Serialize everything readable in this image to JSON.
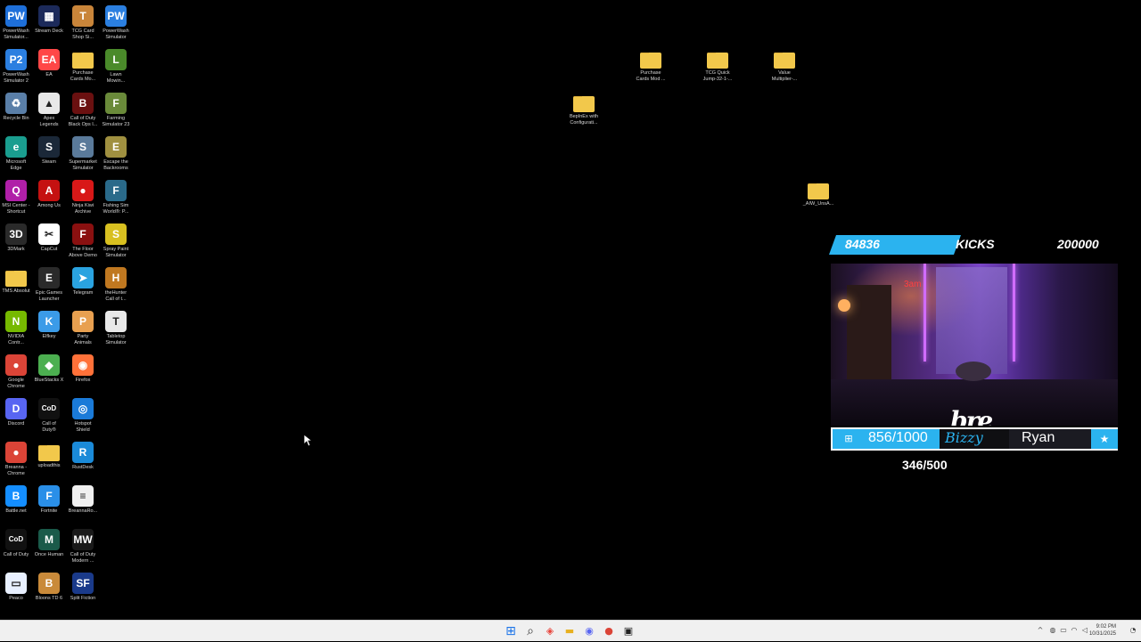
{
  "desktop": {
    "col1": [
      {
        "label": "PowerWash\nSimulator...",
        "icon": "powerwash-icon",
        "color": "#1e6fd9",
        "glyph": "PW"
      },
      {
        "label": "PowerWash\nSimulator 2",
        "icon": "powerwash2-icon",
        "color": "#2b7fe0",
        "glyph": "P2"
      },
      {
        "label": "Recycle Bin",
        "icon": "recycle-bin-icon",
        "color": "#5a7fa8",
        "glyph": "♻"
      },
      {
        "label": "Microsoft\nEdge",
        "icon": "edge-icon",
        "color": "#1a9e8f",
        "glyph": "e"
      },
      {
        "label": "MSI Center -\nShortcut",
        "icon": "msi-center-icon",
        "color": "#b01fa8",
        "glyph": "Q"
      },
      {
        "label": "3DMark",
        "icon": "3dmark-icon",
        "color": "#2a2a2a",
        "glyph": "3D"
      },
      {
        "label": "TMS Absolut",
        "icon": "folder-icon",
        "color": "#f2c84b",
        "glyph": ""
      },
      {
        "label": "NVIDIA\nContr...",
        "icon": "nvidia-icon",
        "color": "#76b900",
        "glyph": "N"
      },
      {
        "label": "Google\nChrome",
        "icon": "chrome-icon",
        "color": "#db4437",
        "glyph": "●"
      },
      {
        "label": "Discord",
        "icon": "discord-icon",
        "color": "#5865f2",
        "glyph": "D"
      },
      {
        "label": "Breanna -\nChrome",
        "icon": "chrome-profile-icon",
        "color": "#db4437",
        "glyph": "●"
      },
      {
        "label": "Battle.net",
        "icon": "battlenet-icon",
        "color": "#148eff",
        "glyph": "B"
      },
      {
        "label": "Call of Duty",
        "icon": "cod-icon",
        "color": "#111111",
        "glyph": "CoD"
      },
      {
        "label": "Peaco",
        "icon": "peaco-icon",
        "color": "#e8f0ff",
        "glyph": "▭"
      }
    ],
    "col2": [
      {
        "label": "Stream Deck",
        "icon": "stream-deck-icon",
        "color": "#1c2a5a",
        "glyph": "▦"
      },
      {
        "label": "EA",
        "icon": "ea-icon",
        "color": "#ff4747",
        "glyph": "EA"
      },
      {
        "label": "Apex\nLegends",
        "icon": "apex-icon",
        "color": "#e8e8e8",
        "glyph": "▲"
      },
      {
        "label": "Steam",
        "icon": "steam-icon",
        "color": "#1b2838",
        "glyph": "S"
      },
      {
        "label": "Among Us",
        "icon": "among-us-icon",
        "color": "#c51111",
        "glyph": "A"
      },
      {
        "label": "CapCut",
        "icon": "capcut-icon",
        "color": "#ffffff",
        "glyph": "✂"
      },
      {
        "label": "Epic Games\nLauncher",
        "icon": "epic-icon",
        "color": "#2a2a2a",
        "glyph": "E"
      },
      {
        "label": "Elfkey",
        "icon": "elfkey-icon",
        "color": "#3b9be8",
        "glyph": "K"
      },
      {
        "label": "BlueStacks X",
        "icon": "bluestacks-icon",
        "color": "#4caf50",
        "glyph": "◆"
      },
      {
        "label": "Call of\nDuty®",
        "icon": "cod-icon",
        "color": "#111111",
        "glyph": "CoD"
      },
      {
        "label": "uploadthis",
        "icon": "folder-icon",
        "color": "#f2c84b",
        "glyph": ""
      },
      {
        "label": "Fortnite",
        "icon": "fortnite-icon",
        "color": "#2a8fe8",
        "glyph": "F"
      },
      {
        "label": "Once Human",
        "icon": "once-human-icon",
        "color": "#1a5a4a",
        "glyph": "M"
      },
      {
        "label": "Bloons TD 6",
        "icon": "bloons-icon",
        "color": "#c98a3a",
        "glyph": "B"
      }
    ],
    "col3": [
      {
        "label": "TCG Card\nShop Si...",
        "icon": "tcg-icon",
        "color": "#c9853a",
        "glyph": "T"
      },
      {
        "label": "Purchase\nCards Mo...",
        "icon": "folder-icon",
        "color": "#f2c84b",
        "glyph": ""
      },
      {
        "label": "Call of Duty\nBlack Ops I...",
        "icon": "cod-bo-icon",
        "color": "#6a1010",
        "glyph": "B"
      },
      {
        "label": "Supermarket\nSimulator",
        "icon": "supermarket-icon",
        "color": "#5a7a9a",
        "glyph": "S"
      },
      {
        "label": "Ninja Kiwi\nArchive",
        "icon": "ninja-kiwi-icon",
        "color": "#d81818",
        "glyph": "●"
      },
      {
        "label": "The Floor\nAbove Demo",
        "icon": "floor-above-icon",
        "color": "#8a1010",
        "glyph": "F"
      },
      {
        "label": "Telegram",
        "icon": "telegram-icon",
        "color": "#2aa3e0",
        "glyph": "➤"
      },
      {
        "label": "Party\nAnimals",
        "icon": "party-animals-icon",
        "color": "#e8a050",
        "glyph": "P"
      },
      {
        "label": "Firefox",
        "icon": "firefox-icon",
        "color": "#ff7139",
        "glyph": "◉"
      },
      {
        "label": "Hotspot\nShield",
        "icon": "hotspot-icon",
        "color": "#1a7ad8",
        "glyph": "◎"
      },
      {
        "label": "RustDesk",
        "icon": "rustdesk-icon",
        "color": "#1a8ad8",
        "glyph": "R"
      },
      {
        "label": "BreannaRo...",
        "icon": "document-icon",
        "color": "#f0f0f0",
        "glyph": "≡"
      },
      {
        "label": "Call of Duty\nModern ...",
        "icon": "mw2-icon",
        "color": "#1a1a1a",
        "glyph": "MW"
      },
      {
        "label": "Split Fiction",
        "icon": "split-fiction-icon",
        "color": "#1a3a8a",
        "glyph": "SF"
      }
    ],
    "col4": [
      {
        "label": "PowerWash\nSimulator",
        "icon": "powerwash-icon",
        "color": "#2b7fe0",
        "glyph": "PW"
      },
      {
        "label": "Lawn\nMowin...",
        "icon": "lawn-icon",
        "color": "#4a8a2a",
        "glyph": "L"
      },
      {
        "label": "Farming\nSimulator 23",
        "icon": "farming-icon",
        "color": "#6a8a3a",
        "glyph": "F"
      },
      {
        "label": "Escape the\nBackrooms",
        "icon": "backrooms-icon",
        "color": "#a09040",
        "glyph": "E"
      },
      {
        "label": "Fishing Sim\nWorld®: P...",
        "icon": "fishing-icon",
        "color": "#2a6a8a",
        "glyph": "F"
      },
      {
        "label": "Spray Paint\nSimulator",
        "icon": "spray-paint-icon",
        "color": "#d8c020",
        "glyph": "S"
      },
      {
        "label": "theHunter\nCall of t...",
        "icon": "thehunter-icon",
        "color": "#c07820",
        "glyph": "H"
      },
      {
        "label": "Tabletop\nSimulator",
        "icon": "tabletop-icon",
        "color": "#e8e8e8",
        "glyph": "T"
      }
    ],
    "loose": [
      {
        "label": "Purchase\nCards Mod ...",
        "icon": "folder-icon"
      },
      {
        "label": "TCG Quick\nJump-32-1-...",
        "icon": "folder-icon"
      },
      {
        "label": "Value\nMultiplier-...",
        "icon": "folder-icon"
      },
      {
        "label": "BepInEx with\nConfigurati...",
        "icon": "folder-icon"
      },
      {
        "label": "_AIW_UnsA...",
        "icon": "folder-icon"
      }
    ]
  },
  "overlay": {
    "kick_count": "84836",
    "kick_label": "KICKS",
    "kick_goal": "200000",
    "goal_progress": "856/1000",
    "goal_mid": "Bizzy",
    "goal_name": "Ryan",
    "sub_progress": "346/500",
    "neon_sign": "3am",
    "cam_logo": "bre",
    "accent": "#2bb3ef"
  },
  "taskbar": {
    "start": "⊞",
    "search": "⌕",
    "clock_time": "9:02 PM",
    "clock_date": "10/31/2025"
  }
}
